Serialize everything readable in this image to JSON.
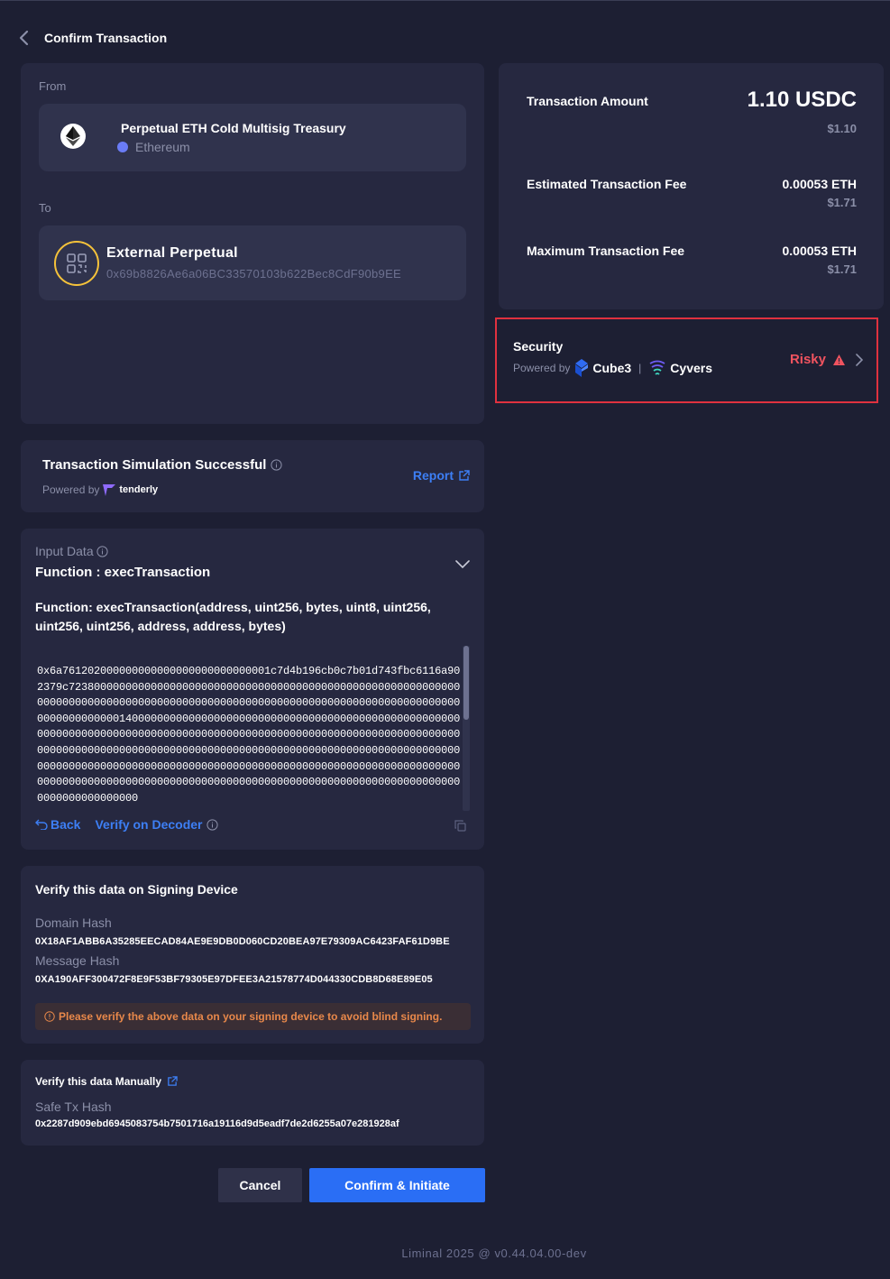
{
  "header": {
    "title": "Confirm Transaction"
  },
  "from": {
    "label": "From",
    "wallet_name": "Perpetual ETH Cold Multisig Treasury",
    "chain": "Ethereum"
  },
  "to": {
    "label": "To",
    "name": "External Perpetual",
    "address": "0x69b8826Ae6a06BC33570103b622Bec8CdF90b9EE"
  },
  "amounts": {
    "transaction_amount_label": "Transaction Amount",
    "transaction_amount": "1.10 USDC",
    "transaction_amount_usd": "$1.10",
    "est_fee_label": "Estimated Transaction Fee",
    "est_fee": "0.00053 ETH",
    "est_fee_usd": "$1.71",
    "max_fee_label": "Maximum Transaction Fee",
    "max_fee": "0.00053 ETH",
    "max_fee_usd": "$1.71"
  },
  "security": {
    "title": "Security",
    "powered_by": "Powered by",
    "provider1": "Cube3",
    "separator": "|",
    "provider2": "Cyvers",
    "status": "Risky",
    "status_color": "#f0535f"
  },
  "simulation": {
    "title": "Transaction Simulation Successful",
    "powered_by": "Powered by",
    "provider": "tenderly",
    "report_label": "Report"
  },
  "input_data": {
    "label": "Input Data",
    "function_title": "Function : execTransaction",
    "signature": "Function: execTransaction(address, uint256, bytes, uint8, uint256, uint256, uint256, address, address, bytes)",
    "hex": "0x6a761202000000000000000000000000001c7d4b196cb0c7b01d743fbc6116a902379c723800000000000000000000000000000000000000000000000000000000000000000000000000000000000000000000000000000000000000000000000000000000000000000014000000000000000000000000000000000000000000000000000000000000000000000000000000000000000000000000000000000000000000000000000000000000000000000000000000000000000000000000000000000000000000000000000000000000000000000000000000000000000000000000000000000000000000000000000000000000000000000000000000000000000000000000000000000000000000000000",
    "back_label": "Back",
    "verify_label": "Verify on Decoder"
  },
  "verify_signing": {
    "title": "Verify this data on Signing Device",
    "domain_hash_label": "Domain Hash",
    "domain_hash": "0X18AF1ABB6A35285EECAD84AE9E9DB0D060CD20BEA97E79309AC6423FAF61D9BE",
    "message_hash_label": "Message Hash",
    "message_hash": "0XA190AFF300472F8E9F53BF79305E97DFEE3A21578774D044330CDB8D68E89E05",
    "warning": "Please verify the above data on your signing device to avoid blind signing."
  },
  "verify_manual": {
    "title": "Verify this data Manually",
    "safe_hash_label": "Safe Tx Hash",
    "safe_hash": "0x2287d909ebd6945083754b7501716a19116d9d5eadf7de2d6255a07e281928af"
  },
  "actions": {
    "cancel": "Cancel",
    "confirm": "Confirm & Initiate"
  },
  "footer": {
    "text": "Liminal 2025 @ v0.44.04.00-dev"
  }
}
